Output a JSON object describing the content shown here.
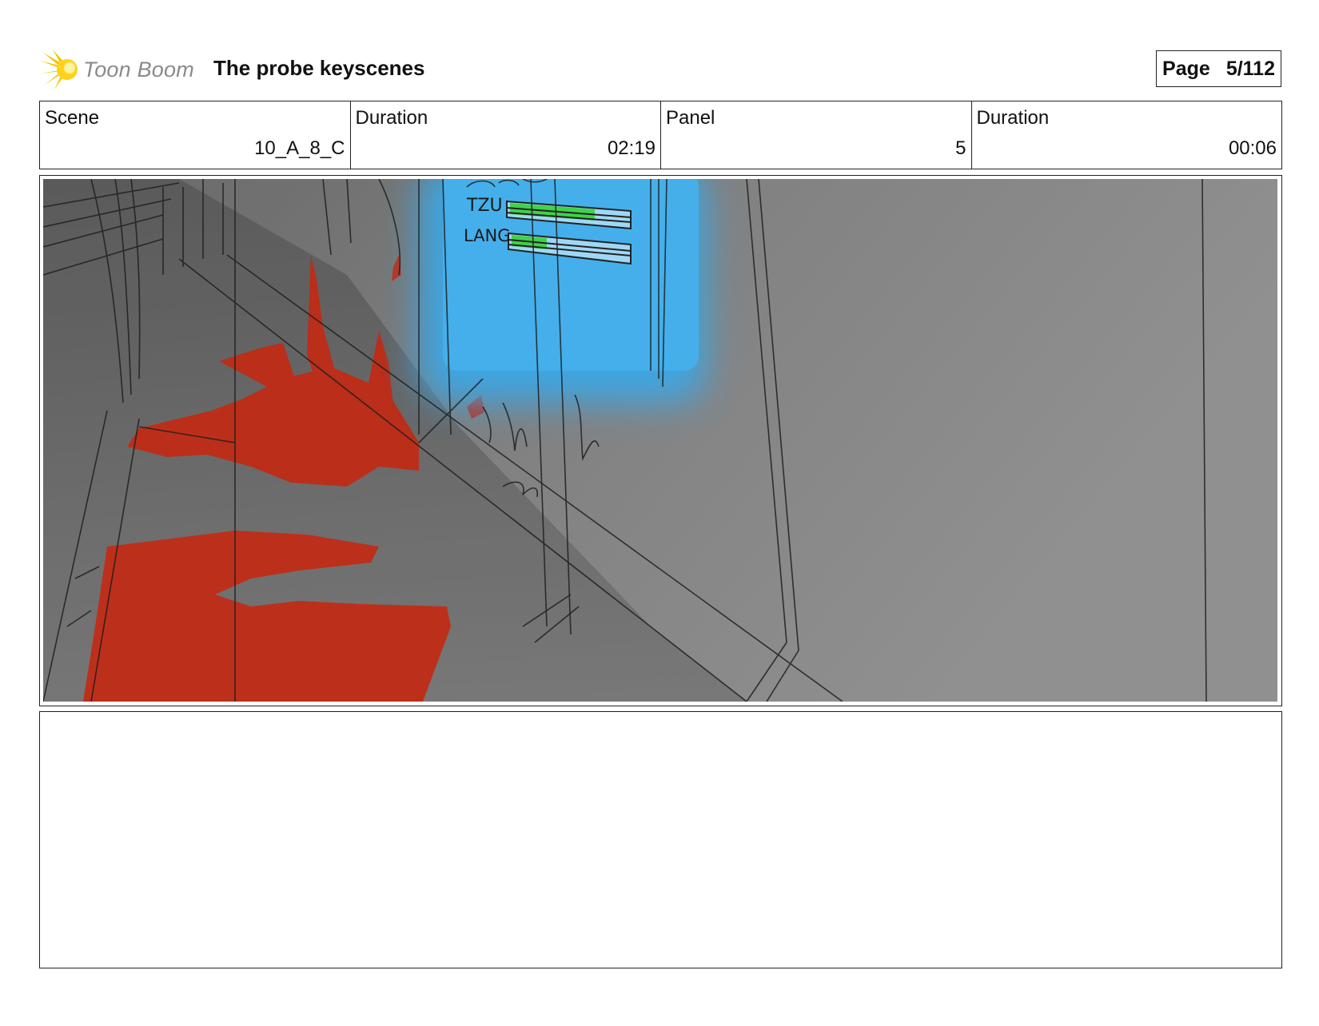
{
  "header": {
    "logo_text": "Toon Boom",
    "doc_title": "The probe keyscenes",
    "page_label": "Page",
    "page_number": "5/112"
  },
  "info": {
    "scene_label": "Scene",
    "scene_value": "10_A_8_C",
    "scene_duration_label": "Duration",
    "scene_duration_value": "02:19",
    "panel_label": "Panel",
    "panel_value": "5",
    "panel_duration_label": "Duration",
    "panel_duration_value": "00:06"
  },
  "panel_sketch": {
    "screen_label_1": "TZU",
    "screen_label_2": "LANG",
    "colors": {
      "blood": "#c22a14",
      "screen_glow": "#3aa7e6",
      "health_bar": "#3fd24a",
      "wall_gray": "#8c8c8c"
    }
  },
  "notes": {
    "text": ""
  }
}
